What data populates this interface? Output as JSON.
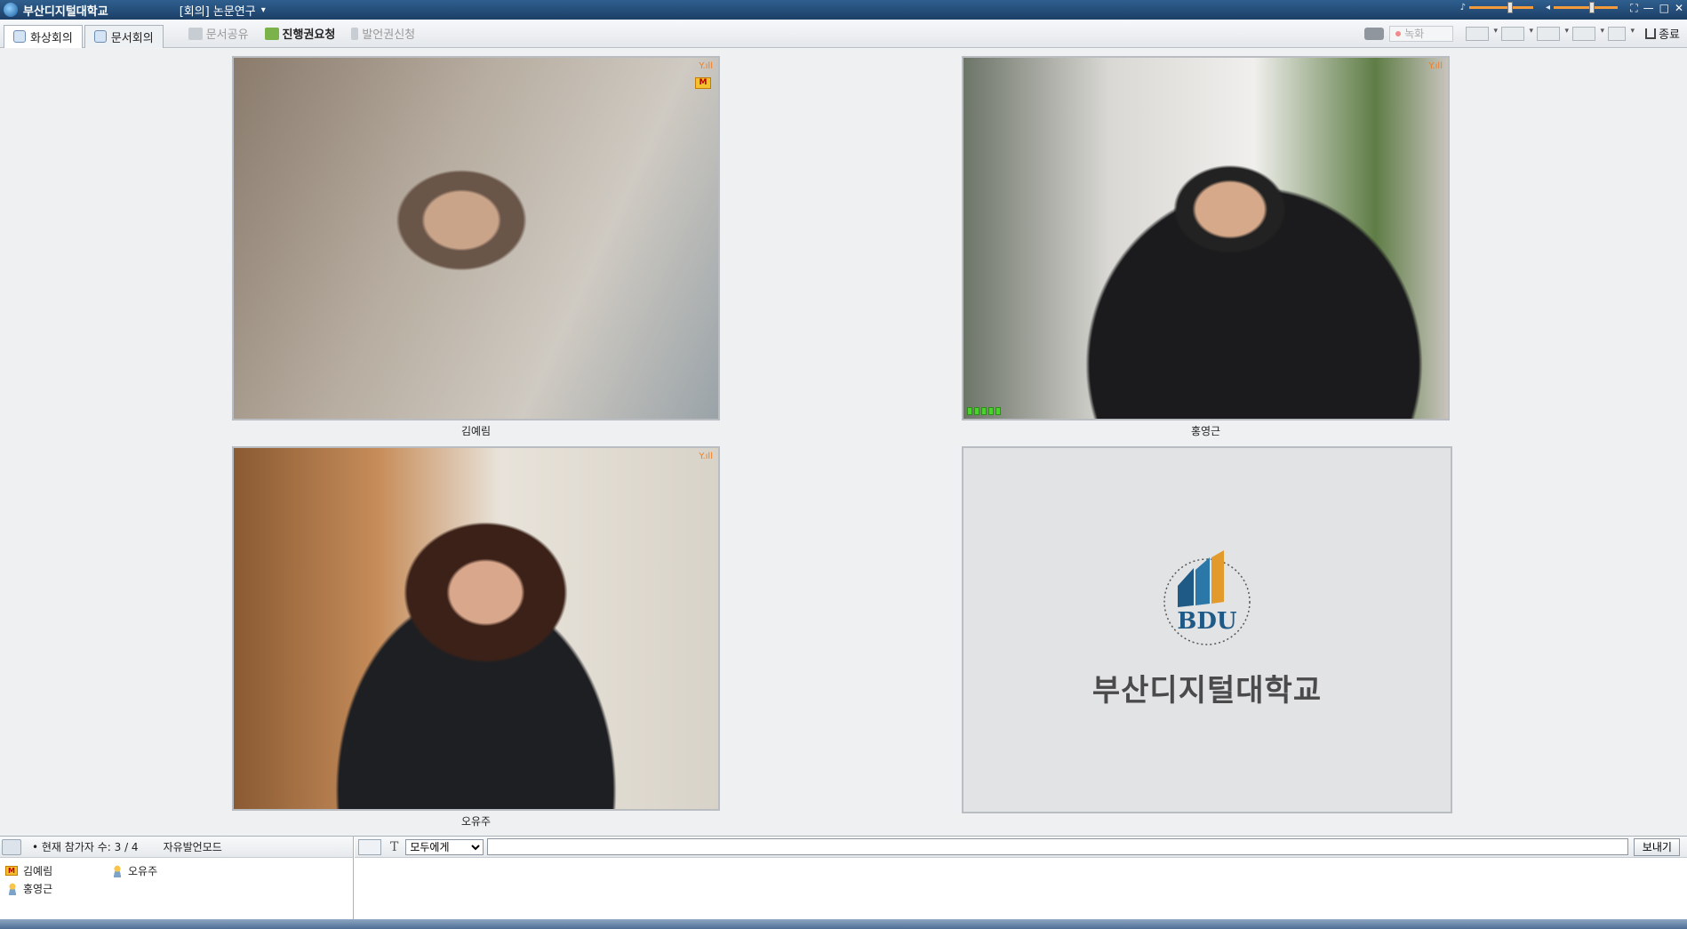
{
  "window": {
    "app_title": "부산디지털대학교",
    "room_title": "[회의] 논문연구",
    "room_caret": "▾",
    "speaker_icon": "♪",
    "mic_icon": "◂",
    "win_controls": [
      "⛶",
      "—",
      "□",
      "✕"
    ]
  },
  "toolbar": {
    "tabs": [
      {
        "label": "화상회의",
        "active": true
      },
      {
        "label": "문서회의",
        "active": false
      }
    ],
    "doc_share": "문서공유",
    "request_control": "진행권요청",
    "request_speak": "발언권신청",
    "record_label": "녹화",
    "exit_label": "종료"
  },
  "tiles": [
    {
      "name": "김예림",
      "signal": "Y.ıll",
      "badge": "M"
    },
    {
      "name": "홍영근",
      "signal": "Y.ıll"
    },
    {
      "name": "오유주",
      "signal": "Y.ıll"
    },
    {
      "logo_text": "BDU",
      "logo_arc": "BUSAN DIGITAL UNIVERSITY",
      "caption": "부산디지털대학교"
    }
  ],
  "participants": {
    "count_text": "• 현재 참가자 수: 3 / 4",
    "mode": "자유발언모드",
    "list": [
      {
        "name": "김예림",
        "role": "moderator",
        "badge": "M"
      },
      {
        "name": "오유주",
        "role": "user"
      },
      {
        "name": "홍영근",
        "role": "user"
      }
    ]
  },
  "chat": {
    "font_icon": "T",
    "target": "모두에게",
    "input_value": "",
    "send_label": "보내기"
  },
  "colors": {
    "titlebar": "#1c3f66",
    "accent": "#f39a3b",
    "meter": "#48d42a"
  }
}
